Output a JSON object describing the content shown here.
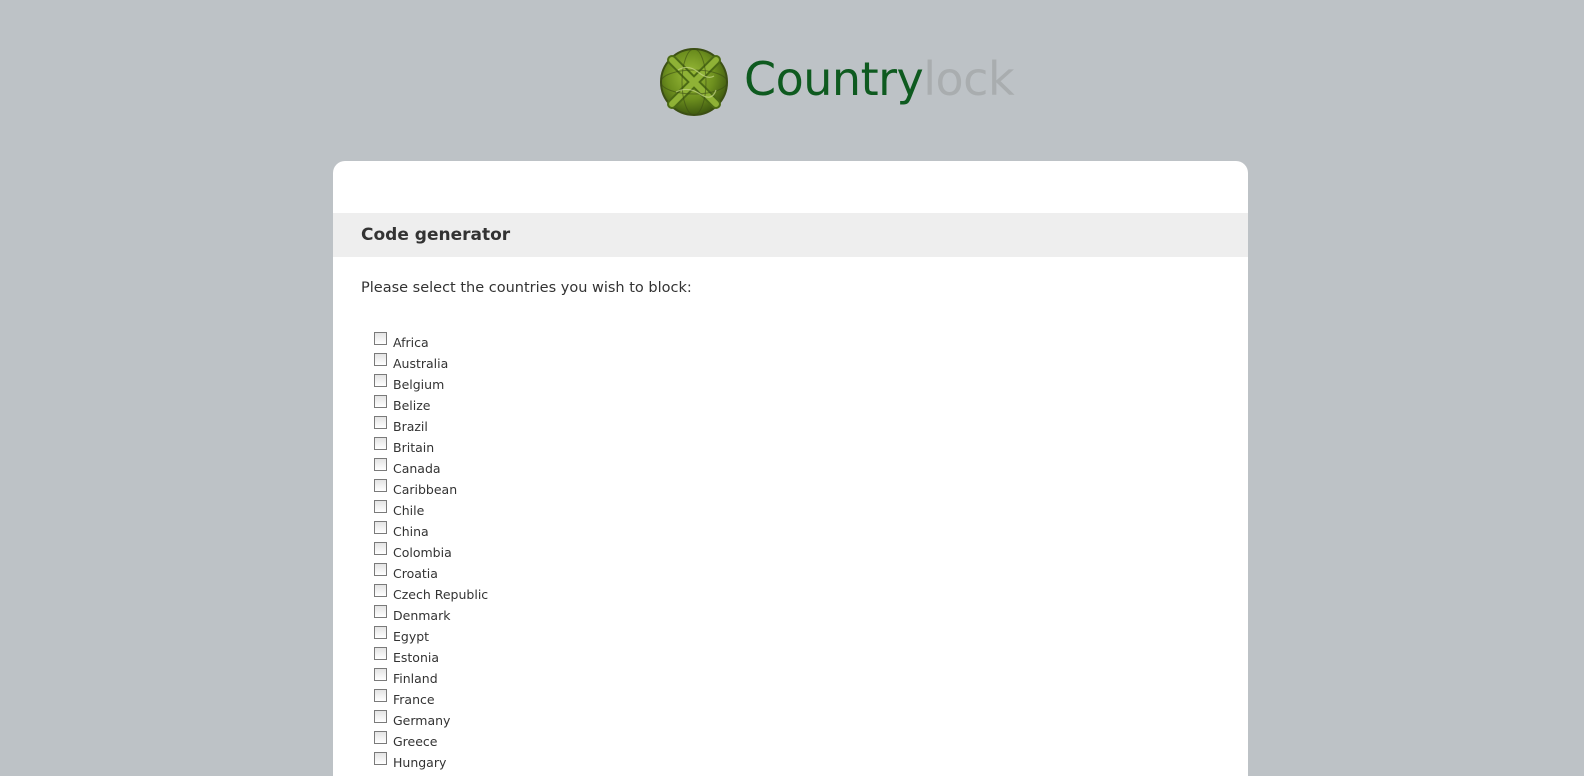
{
  "logo": {
    "brand_main": "Country",
    "brand_sub": "lock",
    "icon": "globe-lock-icon",
    "brand_color": "#0e5a1f",
    "sub_color": "#a9adaf"
  },
  "section": {
    "title": "Code generator"
  },
  "form": {
    "instruction": "Please select the countries you wish to block:",
    "countries": [
      {
        "label": "Africa",
        "checked": false
      },
      {
        "label": "Australia",
        "checked": false
      },
      {
        "label": "Belgium",
        "checked": false
      },
      {
        "label": "Belize",
        "checked": false
      },
      {
        "label": "Brazil",
        "checked": false
      },
      {
        "label": "Britain",
        "checked": false
      },
      {
        "label": "Canada",
        "checked": false
      },
      {
        "label": "Caribbean",
        "checked": false
      },
      {
        "label": "Chile",
        "checked": false
      },
      {
        "label": "China",
        "checked": false
      },
      {
        "label": "Colombia",
        "checked": false
      },
      {
        "label": "Croatia",
        "checked": false
      },
      {
        "label": "Czech Republic",
        "checked": false
      },
      {
        "label": "Denmark",
        "checked": false
      },
      {
        "label": "Egypt",
        "checked": false
      },
      {
        "label": "Estonia",
        "checked": false
      },
      {
        "label": "Finland",
        "checked": false
      },
      {
        "label": "France",
        "checked": false
      },
      {
        "label": "Germany",
        "checked": false
      },
      {
        "label": "Greece",
        "checked": false
      },
      {
        "label": "Hungary",
        "checked": false
      }
    ]
  },
  "colors": {
    "page_background": "#bdc2c6",
    "card_background": "#ffffff",
    "section_bar": "#eeeeee",
    "text": "#333333"
  }
}
